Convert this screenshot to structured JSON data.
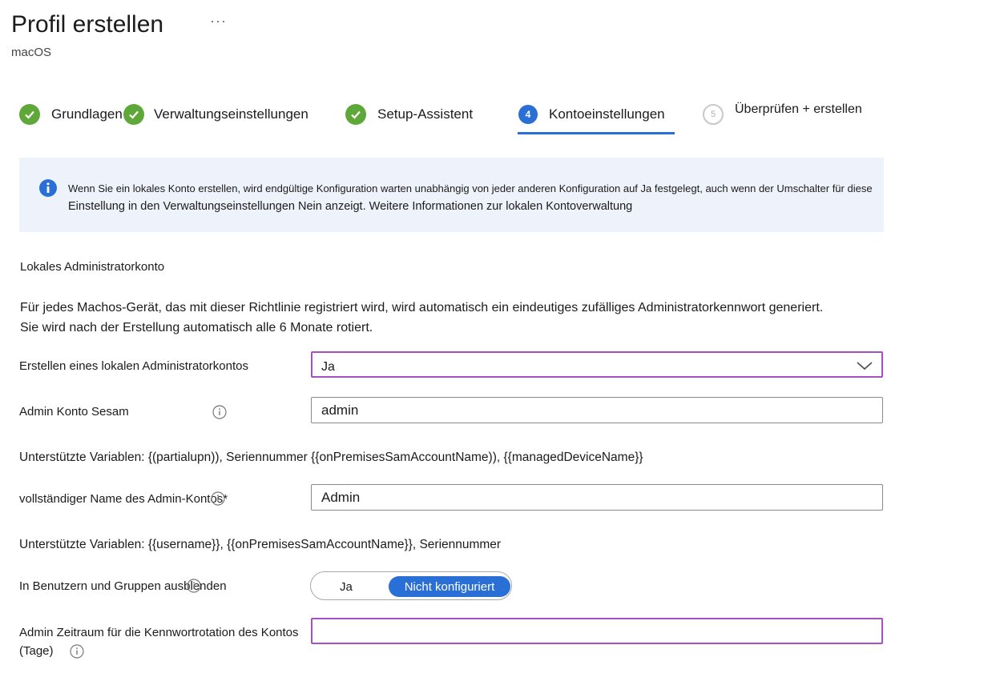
{
  "header": {
    "title": "Profil erstellen",
    "more_glyph": "···",
    "subtitle": "macOS"
  },
  "steps": [
    {
      "label": "Grundlagen",
      "state": "done"
    },
    {
      "label": "Verwaltungseinstellungen",
      "state": "done"
    },
    {
      "label": "Setup-Assistent",
      "state": "done"
    },
    {
      "label": "Kontoeinstellungen",
      "number": "4",
      "state": "active"
    },
    {
      "label": "Überprüfen + erstellen",
      "number": "5",
      "state": "upcoming"
    }
  ],
  "banner": {
    "line1": "Wenn Sie ein lokales Konto erstellen, wird endgültige Konfiguration warten unabhängig von jeder anderen Konfiguration auf Ja festgelegt, auch wenn der Umschalter für diese",
    "line2": "Einstellung in den Verwaltungseinstellungen Nein anzeigt. Weitere Informationen zur lokalen Kontoverwaltung",
    "icon": "info-icon"
  },
  "section": {
    "label": "Lokales Administratorkonto",
    "desc_line1": "Für jedes Machos-Gerät, das mit dieser Richtlinie registriert wird, wird automatisch ein eindeutiges zufälliges Administratorkennwort generiert.",
    "desc_line2": "Sie wird nach der Erstellung automatisch alle 6 Monate rotiert."
  },
  "form": {
    "create_local_admin": {
      "label": "Erstellen eines lokalen Administratorkontos",
      "value": "Ja"
    },
    "admin_account_name": {
      "label": "Admin Konto Sesam",
      "value": "admin"
    },
    "vars1": "Unterstützte Variablen: {(partialupn)), Seriennummer {{onPremisesSamAccountName)), {{managedDeviceName}}",
    "admin_full_name": {
      "label": "vollständiger Name des Admin-Kontos*",
      "value": "Admin"
    },
    "vars2": "Unterstützte Variablen: {{username}}, {{onPremisesSamAccountName}}, Seriennummer",
    "hide_in_users": {
      "label": "In Benutzern und Gruppen ausblenden",
      "option_yes": "Ja",
      "option_selected": "Nicht konfiguriert"
    },
    "rotation_period": {
      "label_line1": "Admin Zeitraum für die Kennwortrotation des Kontos",
      "label_line2": "(Tage)",
      "value": ""
    }
  },
  "colors": {
    "accent": "#2a6fd6",
    "success": "#5ea83a",
    "focus_border": "#a74fc5",
    "banner_bg": "#eef3fb"
  }
}
